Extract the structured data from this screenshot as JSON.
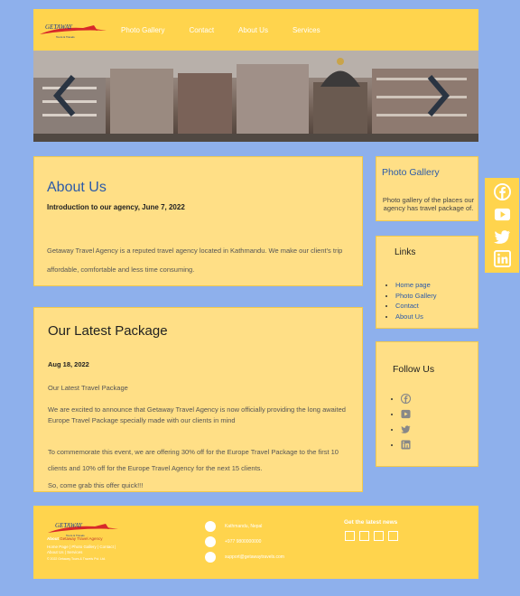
{
  "brand": {
    "name": "GETAWAY",
    "tagline": "Tours & Travels"
  },
  "nav": [
    "Photo Gallery",
    "Contact",
    "About Us",
    "Services"
  ],
  "about": {
    "title": "About Us",
    "subtitle": "Introduction to our agency, June 7, 2022",
    "body": "Getaway Travel Agency is a reputed travel agency located in Kathmandu. We make our client's trip affordable, comfortable and less time consuming."
  },
  "package": {
    "title": "Our Latest Package",
    "date": "Aug 18, 2022",
    "p1": "Our Latest Travel Package",
    "p2": "We are excited to announce that Getaway Travel Agency is now officially providing the long awaited Europe Travel Package specially made with our clients in mind",
    "p3": "To commemorate this event, we are offering 30% off for the Europe Travel Package to the first 10 clients and 10% off for the Europe Travel Agency for the next 15 clients.",
    "p4": "So, come grab this offer quick!!!"
  },
  "gallery": {
    "title": "Photo Gallery",
    "text": "Photo gallery of the places our agency has travel package of."
  },
  "links": {
    "title": "Links",
    "items": [
      "Home page",
      "Photo Gallery",
      "Contact",
      "About Us"
    ]
  },
  "follow": {
    "title": "Follow Us",
    "icons": [
      "facebook-icon",
      "youtube-icon",
      "twitter-icon",
      "linkedin-icon"
    ]
  },
  "social_bar": [
    "facebook-icon",
    "youtube-icon",
    "twitter-icon",
    "linkedin-icon"
  ],
  "footer": {
    "about_label": "About",
    "about_text": "Getaway Travel Agency",
    "links_line1": "Home Page | Photo Gallery | Contact |",
    "links_line2": "About Us | Services",
    "copyright": "© 2022 Getaway Tours & Travels Pvt. Ltd.",
    "address": "Kathmandu, Nepal",
    "phone": "+977 9800000000",
    "email": "support@getawaytravels.com",
    "news_title": "Get the latest news"
  },
  "colors": {
    "background": "#8eb0ec",
    "header": "#ffd44d",
    "card": "#ffdf86",
    "link": "#2b5aa8"
  }
}
